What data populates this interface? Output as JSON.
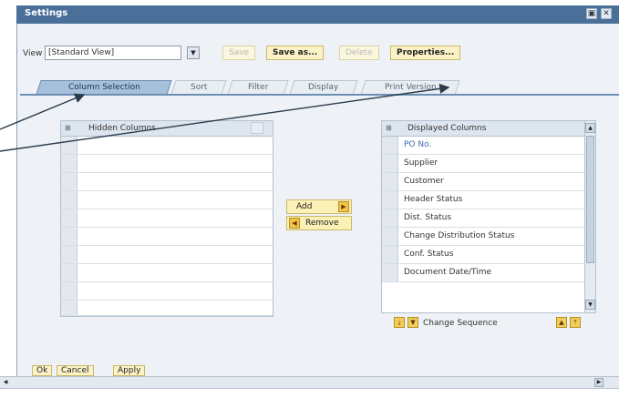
{
  "window": {
    "title": "Settings"
  },
  "toolbar": {
    "view_label": "View",
    "view_value": "[Standard View]",
    "save_label": "Save",
    "save_as_label": "Save as...",
    "delete_label": "Delete",
    "properties_label": "Properties..."
  },
  "tabs": [
    {
      "label": "Column Selection",
      "active": true
    },
    {
      "label": "Sort"
    },
    {
      "label": "Filter"
    },
    {
      "label": "Display"
    },
    {
      "label": "Print Version"
    }
  ],
  "hidden_columns": {
    "header": "Hidden Columns",
    "rows": [
      "",
      "",
      "",
      "",
      "",
      "",
      "",
      "",
      "",
      ""
    ]
  },
  "move": {
    "add_label": "Add",
    "remove_label": "Remove"
  },
  "displayed_columns": {
    "header": "Displayed Columns",
    "rows": [
      "PO No.",
      "Supplier",
      "Customer",
      "Header Status",
      "Dist. Status",
      "Change Distribution Status",
      "Conf. Status",
      "Document Date/Time"
    ]
  },
  "sequence": {
    "label": "Change Sequence"
  },
  "footer": {
    "ok_label": "Ok",
    "cancel_label": "Cancel",
    "apply_label": "Apply"
  },
  "colors": {
    "title_bar": "#4a6f99",
    "active_tab": "#a7c0da",
    "button_fill": "#fbf3c7",
    "po_link": "#3b6aa8"
  },
  "icons": [
    "collapse-icon",
    "close-icon",
    "dropdown-icon",
    "arrow-right-icon",
    "arrow-left-icon",
    "scroll-up-icon",
    "scroll-down-icon",
    "move-bottom-icon",
    "move-down-icon",
    "move-up-icon",
    "move-top-icon"
  ]
}
